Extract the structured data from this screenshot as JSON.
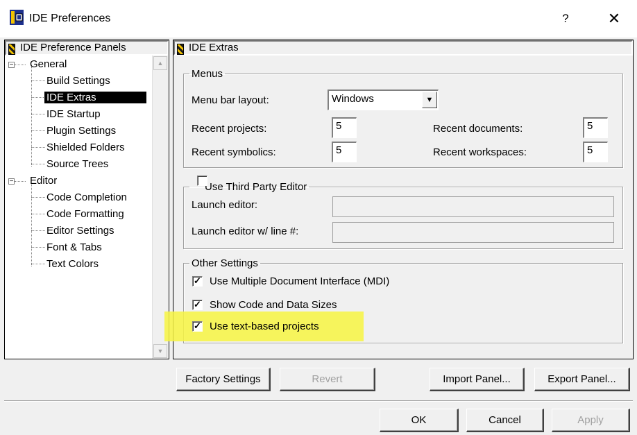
{
  "window": {
    "title": "IDE Preferences",
    "help_label": "?",
    "close_label": "✕"
  },
  "left_panel": {
    "header": "IDE Preference Panels",
    "tree": [
      {
        "label": "General",
        "expander": "−"
      },
      {
        "label": "Build Settings"
      },
      {
        "label": "IDE Extras",
        "selected": true
      },
      {
        "label": "IDE Startup"
      },
      {
        "label": "Plugin Settings"
      },
      {
        "label": "Shielded Folders"
      },
      {
        "label": "Source Trees"
      },
      {
        "label": "Editor",
        "expander": "−"
      },
      {
        "label": "Code Completion"
      },
      {
        "label": "Code Formatting"
      },
      {
        "label": "Editor Settings"
      },
      {
        "label": "Font & Tabs"
      },
      {
        "label": "Text Colors"
      }
    ]
  },
  "right_panel": {
    "header": "IDE Extras",
    "menus": {
      "legend": "Menus",
      "menu_bar_layout_label": "Menu bar layout:",
      "menu_bar_layout_value": "Windows",
      "recent_projects_label": "Recent projects:",
      "recent_projects_value": "5",
      "recent_documents_label": "Recent documents:",
      "recent_documents_value": "5",
      "recent_symbolics_label": "Recent symbolics:",
      "recent_symbolics_value": "5",
      "recent_workspaces_label": "Recent workspaces:",
      "recent_workspaces_value": "5"
    },
    "third_party": {
      "legend": "Use Third Party Editor",
      "checked": false,
      "launch_editor_label": "Launch editor:",
      "launch_editor_value": "",
      "launch_editor_line_label": "Launch editor w/ line #:",
      "launch_editor_line_value": ""
    },
    "other": {
      "legend": "Other Settings",
      "mdi_label": "Use Multiple Document Interface (MDI)",
      "mdi_checked": true,
      "sizes_label": "Show Code and Data Sizes",
      "sizes_checked": true,
      "text_projects_label": "Use text-based projects",
      "text_projects_checked": true
    },
    "check_mark": "✓"
  },
  "panel_buttons": {
    "factory": "Factory Settings",
    "revert": "Revert",
    "import": "Import Panel...",
    "export": "Export Panel..."
  },
  "dialog_buttons": {
    "ok": "OK",
    "cancel": "Cancel",
    "apply": "Apply"
  },
  "colors": {
    "highlight": "#f7f542",
    "selection": "#000000"
  }
}
